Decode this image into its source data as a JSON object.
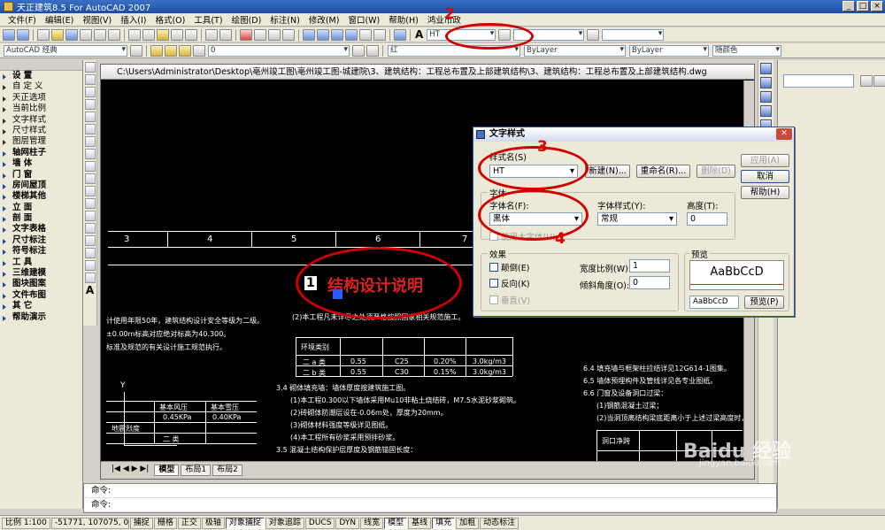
{
  "app": {
    "title": "天正建筑8.5 For AutoCAD 2007"
  },
  "menu": [
    "文件(F)",
    "编辑(E)",
    "视图(V)",
    "插入(I)",
    "格式(O)",
    "工具(T)",
    "绘图(D)",
    "标注(N)",
    "修改(M)",
    "窗口(W)",
    "帮助(H)",
    "鸿业市政"
  ],
  "toolbar": {
    "text_style_combo": "HT",
    "workspace_combo": "AutoCAD 经典",
    "layer_combo": "0",
    "color_combo": "红",
    "linetype_combo": "ByLayer",
    "lineweight_combo": "ByLayer",
    "plotstyle_combo": "随颜色"
  },
  "left_palette": {
    "items": [
      {
        "label": "设  置",
        "header": true
      },
      {
        "label": "自 定 义"
      },
      {
        "label": "天正选项"
      },
      {
        "label": "当前比例"
      },
      {
        "label": "文字样式"
      },
      {
        "label": "尺寸样式"
      },
      {
        "label": "图层管理"
      },
      {
        "label": "轴网柱子",
        "header": true
      },
      {
        "label": "墙   体",
        "header": true
      },
      {
        "label": "门   窗",
        "header": true
      },
      {
        "label": "房间屋顶",
        "header": true
      },
      {
        "label": "楼梯其他",
        "header": true
      },
      {
        "label": "立   面",
        "header": true
      },
      {
        "label": "剖   面",
        "header": true
      },
      {
        "label": "文字表格",
        "header": true
      },
      {
        "label": "尺寸标注",
        "header": true
      },
      {
        "label": "符号标注",
        "header": true
      },
      {
        "label": "工   具",
        "header": true
      },
      {
        "label": "三维建模",
        "header": true
      },
      {
        "label": "图块图案",
        "header": true
      },
      {
        "label": "文件布图",
        "header": true
      },
      {
        "label": "其   它",
        "header": true
      },
      {
        "label": "帮助演示",
        "header": true
      }
    ]
  },
  "drawing": {
    "window_title": "C:\\Users\\Administrator\\Desktop\\亳州竣工图\\亳州竣工图-城建院\\3、建筑结构：工程总布置及上部建筑结构\\3、建筑结构：工程总布置及上部建筑结构.dwg",
    "tabs": [
      "模型",
      "布局1",
      "布局2"
    ],
    "axis_labels": [
      "3",
      "4",
      "5",
      "6",
      "7"
    ],
    "red_title": "结构设计说明",
    "sample_texts": [
      "计使用年限50年，建筑结构设计安全等级为二级。",
      "±0.00m标高对应绝对标高为40.300。",
      "标准及规范的有关设计施工规范执行。",
      "(2)本工程凡未详尽之处须严格按照国家相关规范施工。",
      "环境类别",
      "二 a 类",
      "二 b 类",
      "0.55",
      "C25",
      "C30",
      "0.20%",
      "0.15%",
      "3.0kg/m3",
      "3.4   砌体填充墙：墙体厚度按建筑施工图。",
      "(1)本工程0.300以下墙体采用Mu10非粘土烧结砖，M7.5水泥砂浆砌筑。",
      "(2)砖砌体防潮层设在-0.06m处，厚度为20mm。",
      "(3)砌体材料强度等级详见图纸。",
      "(4)本工程所有砂浆采用预拌砂浆。",
      "3.5   混凝土结构保护层厚度及钢筋锚固长度：",
      "6.4   填充墙与框架柱拉结详见12G614-1图集。",
      "6.5   墙体预埋构件及管线详见各专业图纸。",
      "6.6   门窗及设备洞口过梁：",
      "(1)钢筋混凝土过梁；",
      "(2)当洞顶离结构梁底距离小于上述过梁高度时，",
      "洞口净跨",
      "基本风压",
      "基本雪压",
      "0.45KPa",
      "0.40KPa",
      "地震烈度",
      "二 类"
    ]
  },
  "annotations": [
    "1",
    "2",
    "3",
    "4"
  ],
  "dialog": {
    "title": "文字样式",
    "style_name_label": "样式名(S)",
    "style_name_value": "HT",
    "new_btn": "新建(N)...",
    "rename_btn": "重命名(R)...",
    "delete_btn": "删除(D)",
    "apply_btn": "应用(A)",
    "cancel_btn": "取消",
    "help_btn": "帮助(H)",
    "font_group": "字体",
    "font_name_label": "字体名(F):",
    "font_name_value": "黑体",
    "font_style_label": "字体样式(Y):",
    "font_style_value": "常规",
    "height_label": "高度(T):",
    "height_value": "0",
    "bigfont_label": "使用大字体(U)",
    "effect_group": "效果",
    "upside_label": "颠倒(E)",
    "backward_label": "反向(K)",
    "vertical_label": "垂直(V)",
    "width_factor_label": "宽度比例(W):",
    "width_factor_value": "1",
    "oblique_label": "倾斜角度(O):",
    "oblique_value": "0",
    "preview_group": "预览",
    "preview_text": "AaBbCcD",
    "preview_input": "AaBbCcD",
    "preview_btn": "预览(P)"
  },
  "command": {
    "line1": "命令:",
    "line2": "命令:"
  },
  "status": {
    "scale": "比例 1:100",
    "coords": "-51771, 107075, 0",
    "toggles": [
      "捕捉",
      "栅格",
      "正交",
      "极轴",
      "对象捕捉",
      "对象追踪",
      "DUCS",
      "DYN",
      "线宽",
      "模型",
      "基线",
      "填充",
      "加粗",
      "动态标注"
    ]
  },
  "watermark": {
    "main": "Baidu 经验",
    "sub": "jingyan.baidu.com"
  }
}
